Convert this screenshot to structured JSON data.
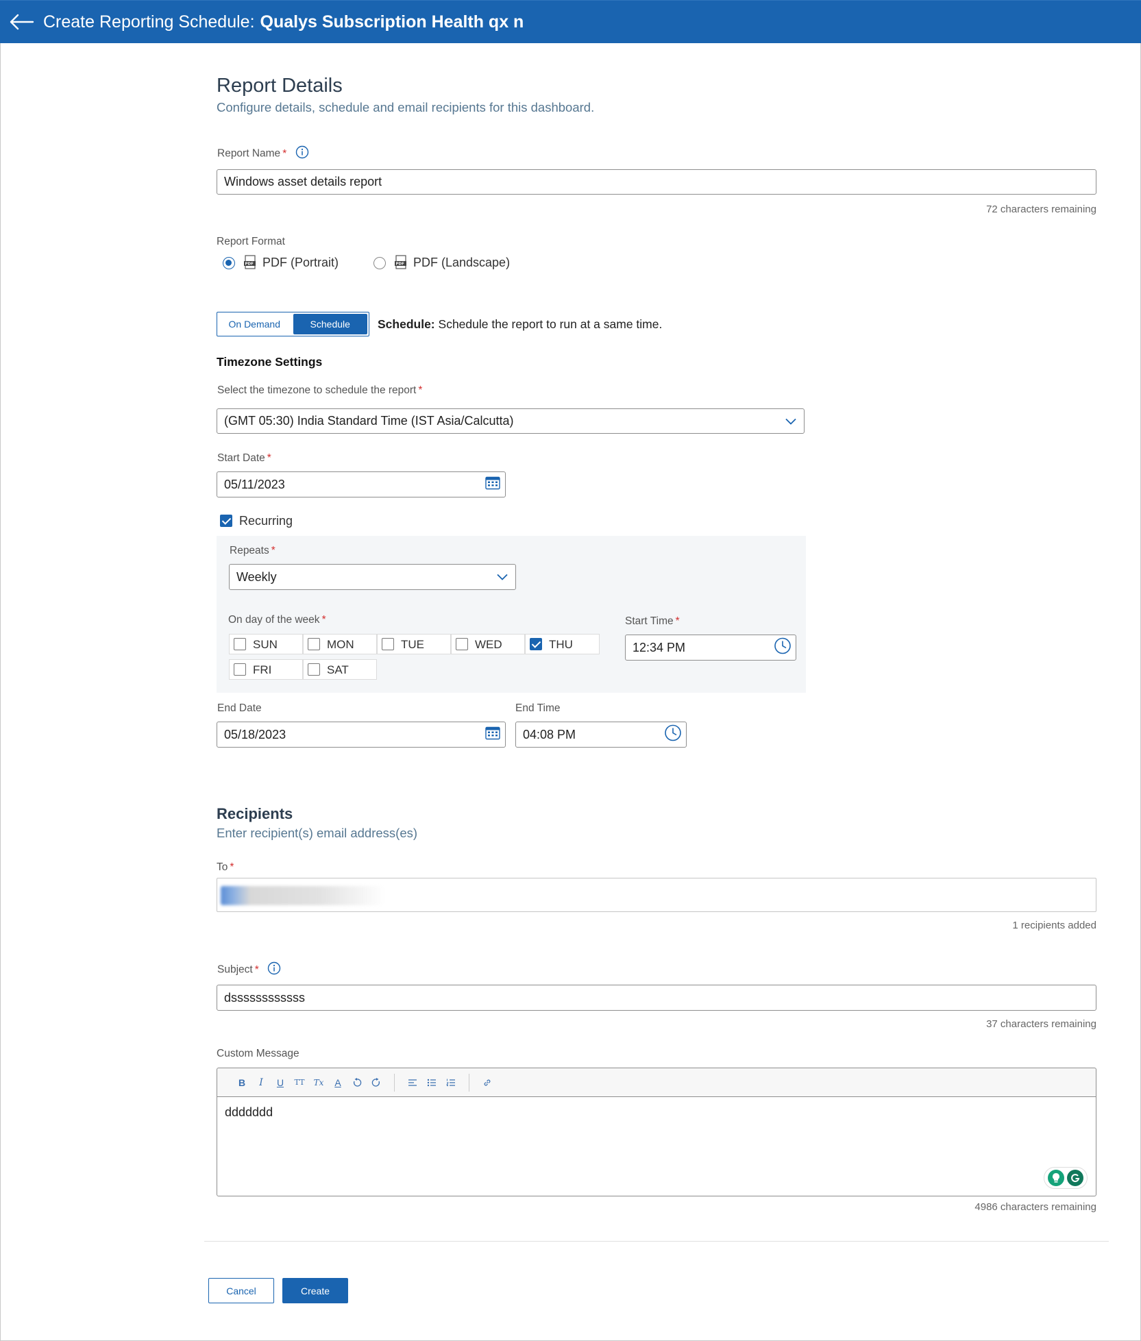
{
  "header": {
    "title_prefix": "Create Reporting Schedule:",
    "title_name": "Qualys Subscription Health qx n"
  },
  "report_details": {
    "heading": "Report Details",
    "subheading": "Configure details, schedule and email recipients for this dashboard.",
    "report_name": {
      "label": "Report Name",
      "required": "*",
      "value": "Windows asset details report",
      "helper": "72 characters remaining"
    },
    "report_format": {
      "label": "Report Format",
      "options": [
        {
          "label": "PDF (Portrait)",
          "selected": true
        },
        {
          "label": "PDF (Landscape)",
          "selected": false
        }
      ]
    }
  },
  "mode_toggle": {
    "options": [
      "On Demand",
      "Schedule"
    ],
    "active": "Schedule",
    "description_bold": "Schedule:",
    "description": "Schedule the report to run at a same time."
  },
  "timezone": {
    "heading": "Timezone Settings",
    "label": "Select the timezone to schedule the report",
    "required": "*",
    "value": "(GMT 05:30) India Standard Time (IST Asia/Calcutta)"
  },
  "start_date": {
    "label": "Start Date",
    "required": "*",
    "value": "05/11/2023"
  },
  "recurring": {
    "label": "Recurring",
    "checked": true,
    "repeats": {
      "label": "Repeats",
      "required": "*",
      "value": "Weekly"
    },
    "days": {
      "label": "On day of the week",
      "required": "*",
      "items": [
        {
          "label": "SUN",
          "checked": false
        },
        {
          "label": "MON",
          "checked": false
        },
        {
          "label": "TUE",
          "checked": false
        },
        {
          "label": "WED",
          "checked": false
        },
        {
          "label": "THU",
          "checked": true
        },
        {
          "label": "FRI",
          "checked": false
        },
        {
          "label": "SAT",
          "checked": false
        }
      ]
    },
    "start_time": {
      "label": "Start Time",
      "required": "*",
      "value": "12:34 PM"
    }
  },
  "end_date": {
    "label": "End Date",
    "value": "05/18/2023"
  },
  "end_time": {
    "label": "End Time",
    "value": "04:08 PM"
  },
  "recipients": {
    "heading": "Recipients",
    "subheading": "Enter recipient(s) email address(es)",
    "to": {
      "label": "To",
      "required": "*",
      "helper": "1 recipients added"
    },
    "subject": {
      "label": "Subject",
      "required": "*",
      "value": "dssssssssssss",
      "helper": "37 characters remaining"
    },
    "custom_message": {
      "label": "Custom Message",
      "value": "ddddddd",
      "helper": "4986 characters remaining",
      "toolbar": {
        "bold": "B",
        "italic": "I",
        "underline": "U",
        "text_size": "TT",
        "clear_format": "Tx",
        "font_color": "A"
      }
    }
  },
  "actions": {
    "cancel": "Cancel",
    "create": "Create"
  },
  "colors": {
    "primary": "#1a64b0",
    "required": "#d32f2f",
    "subtext": "#567791",
    "grammarly": "#15a37a"
  }
}
